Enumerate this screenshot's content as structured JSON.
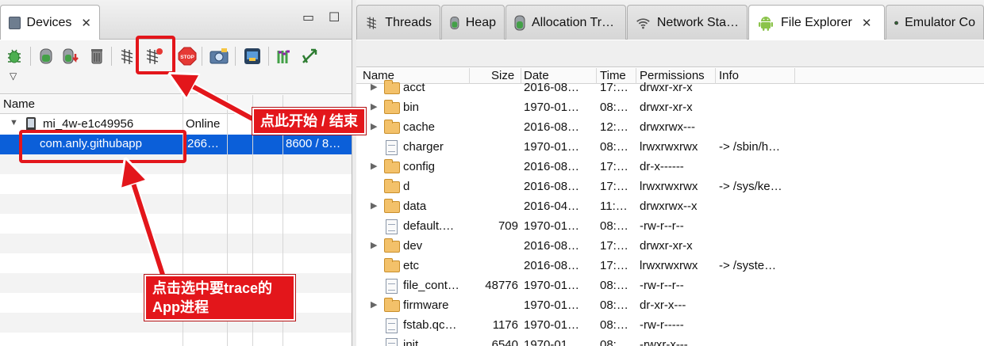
{
  "devices_panel": {
    "tab_label": "Devices",
    "close_glyph": "✕",
    "minimize_glyph": "▭",
    "maximize_glyph": "☐",
    "dropdown_glyph": "▽",
    "toolbar_icons": [
      "debug-icon",
      "update-heap-icon",
      "dump-hprof-icon",
      "cause-gc-icon",
      "update-threads-icon",
      "start-method-profiling-icon",
      "stop-process-icon",
      "screen-capture-icon",
      "dump-view-hierarchy-icon",
      "systrace-icon",
      "opengl-trace-icon"
    ],
    "columns": [
      "Name"
    ],
    "device_row": {
      "name": "mi_4w-e1c49956",
      "status": "Online",
      "extra": ""
    },
    "process_row": {
      "name": "com.anly.githubapp",
      "pid": "266…",
      "port": "8600 / 8…"
    }
  },
  "right_tabs": [
    {
      "label": "Threads",
      "icon": "threads-icon"
    },
    {
      "label": "Heap",
      "icon": "heap-icon"
    },
    {
      "label": "Allocation Tr…",
      "icon": "allocation-icon"
    },
    {
      "label": "Network Sta…",
      "icon": "network-icon"
    },
    {
      "label": "File Explorer",
      "icon": "android-icon"
    },
    {
      "label": "Emulator Co",
      "icon": "emulator-icon"
    }
  ],
  "file_explorer": {
    "columns": [
      "Name",
      "Size",
      "Date",
      "Time",
      "Permissions",
      "Info"
    ],
    "rows": [
      {
        "type": "folder",
        "expand": true,
        "name": "acct",
        "size": "",
        "date": "2016-08…",
        "time": "17:…",
        "perm": "drwxr-xr-x",
        "info": ""
      },
      {
        "type": "folder",
        "expand": true,
        "name": "bin",
        "size": "",
        "date": "1970-01…",
        "time": "08:…",
        "perm": "drwxr-xr-x",
        "info": ""
      },
      {
        "type": "folder",
        "expand": true,
        "name": "cache",
        "size": "",
        "date": "2016-08…",
        "time": "12:…",
        "perm": "drwxrwx---",
        "info": ""
      },
      {
        "type": "file",
        "expand": false,
        "name": "charger",
        "size": "",
        "date": "1970-01…",
        "time": "08:…",
        "perm": "lrwxrwxrwx",
        "info": "-> /sbin/h…"
      },
      {
        "type": "folder",
        "expand": true,
        "name": "config",
        "size": "",
        "date": "2016-08…",
        "time": "17:…",
        "perm": "dr-x------",
        "info": ""
      },
      {
        "type": "folder",
        "expand": false,
        "name": "d",
        "size": "",
        "date": "2016-08…",
        "time": "17:…",
        "perm": "lrwxrwxrwx",
        "info": "-> /sys/ke…"
      },
      {
        "type": "folder",
        "expand": true,
        "name": "data",
        "size": "",
        "date": "2016-04…",
        "time": "11:…",
        "perm": "drwxrwx--x",
        "info": ""
      },
      {
        "type": "file",
        "expand": false,
        "name": "default.…",
        "size": "709",
        "date": "1970-01…",
        "time": "08:…",
        "perm": "-rw-r--r--",
        "info": ""
      },
      {
        "type": "folder",
        "expand": true,
        "name": "dev",
        "size": "",
        "date": "2016-08…",
        "time": "17:…",
        "perm": "drwxr-xr-x",
        "info": ""
      },
      {
        "type": "folder",
        "expand": false,
        "name": "etc",
        "size": "",
        "date": "2016-08…",
        "time": "17:…",
        "perm": "lrwxrwxrwx",
        "info": "-> /syste…"
      },
      {
        "type": "file",
        "expand": false,
        "name": "file_cont…",
        "size": "48776",
        "date": "1970-01…",
        "time": "08:…",
        "perm": "-rw-r--r--",
        "info": ""
      },
      {
        "type": "folder",
        "expand": true,
        "name": "firmware",
        "size": "",
        "date": "1970-01…",
        "time": "08:…",
        "perm": "dr-xr-x---",
        "info": ""
      },
      {
        "type": "file",
        "expand": false,
        "name": "fstab.qc…",
        "size": "1176",
        "date": "1970-01…",
        "time": "08:…",
        "perm": "-rw-r-----",
        "info": ""
      },
      {
        "type": "file",
        "expand": false,
        "name": "init",
        "size": "6540",
        "date": "1970-01…",
        "time": "08:…",
        "perm": "-rwxr-x---",
        "info": ""
      }
    ]
  },
  "annotations": {
    "start_stop": "点此开始 / 结束",
    "select_line1": "点击选中要trace的",
    "select_line2": "App进程",
    "color": "#e3161b"
  }
}
